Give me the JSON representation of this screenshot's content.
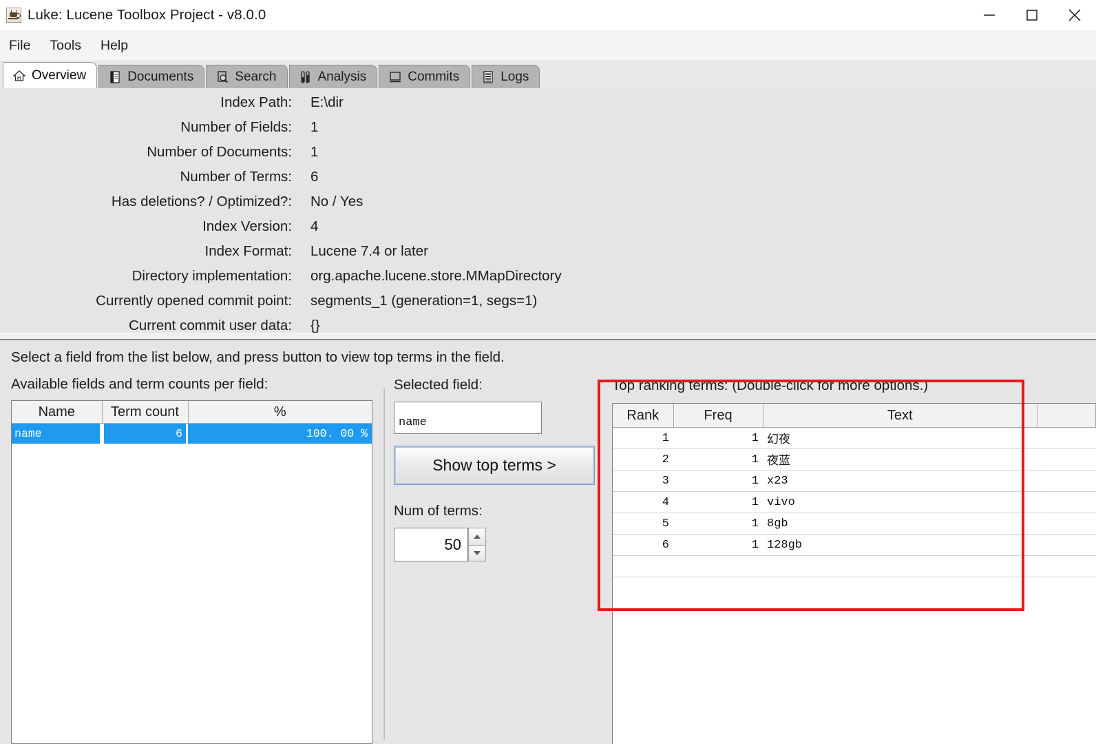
{
  "window": {
    "title": "Luke: Lucene Toolbox Project - v8.0.0",
    "app_icon": "java-coffee-cup-icon",
    "controls": {
      "minimize": "minimize-icon",
      "maximize": "maximize-icon",
      "close": "close-icon"
    }
  },
  "menubar": {
    "items": [
      {
        "label": "File"
      },
      {
        "label": "Tools"
      },
      {
        "label": "Help"
      }
    ]
  },
  "tabs": [
    {
      "label": "Overview",
      "icon": "home-icon",
      "active": true
    },
    {
      "label": "Documents",
      "icon": "document-icon",
      "active": false
    },
    {
      "label": "Search",
      "icon": "magnifier-doc-icon",
      "active": false
    },
    {
      "label": "Analysis",
      "icon": "test-tubes-icon",
      "active": false
    },
    {
      "label": "Commits",
      "icon": "book-icon",
      "active": false
    },
    {
      "label": "Logs",
      "icon": "list-icon",
      "active": false
    }
  ],
  "overview": {
    "rows": [
      {
        "label": "Index Path:",
        "value": "E:\\dir"
      },
      {
        "label": "Number of Fields:",
        "value": "1"
      },
      {
        "label": "Number of Documents:",
        "value": "1"
      },
      {
        "label": "Number of Terms:",
        "value": "6"
      },
      {
        "label": "Has deletions? / Optimized?:",
        "value": "No / Yes"
      },
      {
        "label": "Index Version:",
        "value": "4"
      },
      {
        "label": "Index Format:",
        "value": "Lucene 7.4 or later"
      },
      {
        "label": "Directory implementation:",
        "value": "org.apache.lucene.store.MMapDirectory"
      },
      {
        "label": "Currently opened commit point:",
        "value": "segments_1 (generation=1, segs=1)"
      },
      {
        "label": "Current commit user data:",
        "value": "{}"
      }
    ]
  },
  "fields_section": {
    "hint": "Select a field from the list below, and press button to view top terms in the field.",
    "caption": "Available fields and term counts per field:",
    "columns": [
      "Name",
      "Term count",
      "%"
    ],
    "rows": [
      {
        "name": "name",
        "term_count": "6",
        "percent": "100. 00 %",
        "selected": true
      }
    ]
  },
  "middle": {
    "selected_field_label": "Selected field:",
    "selected_field_value": "name",
    "show_top_terms_label": "Show top terms >",
    "num_of_terms_label": "Num of terms:",
    "num_of_terms_value": "50",
    "spinner_up_icon": "arrow-up-icon",
    "spinner_down_icon": "arrow-down-icon"
  },
  "top_terms": {
    "caption": "Top ranking terms: (Double-click for more options.)",
    "columns": [
      "Rank",
      "Freq",
      "Text",
      ""
    ],
    "rows": [
      {
        "rank": "1",
        "freq": "1",
        "text": "幻夜"
      },
      {
        "rank": "2",
        "freq": "1",
        "text": "夜蓝"
      },
      {
        "rank": "3",
        "freq": "1",
        "text": "x23"
      },
      {
        "rank": "4",
        "freq": "1",
        "text": "vivo"
      },
      {
        "rank": "5",
        "freq": "1",
        "text": "8gb"
      },
      {
        "rank": "6",
        "freq": "1",
        "text": "128gb"
      }
    ]
  },
  "annotation": {
    "highlight_color": "#e01b1b",
    "shape": "rectangle"
  },
  "colors": {
    "selection_blue": "#1f9af0",
    "window_bg": "#e5e5e5",
    "tab_inactive": "#b4b4b4",
    "tab_active": "#ffffff"
  }
}
